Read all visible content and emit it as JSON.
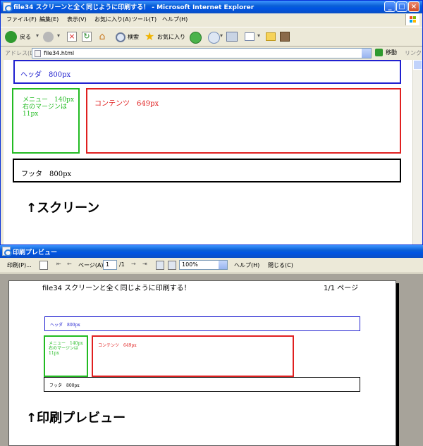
{
  "ie": {
    "title": "file34 スクリーンと全く同じように印刷する！ - Microsoft Internet Explorer",
    "menu": [
      "ファイル(F)",
      "編集(E)",
      "表示(V)",
      "お気に入り(A)",
      "ツール(T)",
      "ヘルプ(H)"
    ],
    "toolbar": {
      "back": "戻る",
      "search": "検索",
      "favorites": "お気に入り"
    },
    "address_label": "アドレス(D)",
    "address_value": "file34.html",
    "go_label": "移動",
    "links_label": "リンク"
  },
  "screen_page": {
    "header": "ヘッダ　800px",
    "menu_lines": [
      "メニュー　140px",
      "右のマージンは",
      "11px"
    ],
    "content": "コンテンツ　649px",
    "footer": "フッタ　800px"
  },
  "caption_screen": "↑スクリーン",
  "preview": {
    "title": "印刷プレビュー",
    "toolbar": {
      "print": "印刷(P)...",
      "page_label": "ページ(A)",
      "page_value": "1",
      "page_total": "/1",
      "zoom": "100%",
      "help": "ヘルプ(H)",
      "close": "閉じる(C)"
    },
    "paper_header_left": "file34 スクリーンと全く同じように印刷する！",
    "paper_header_right": "1/1 ページ",
    "page": {
      "header": "ヘッダ　800px",
      "menu_lines": [
        "メニュー　140px",
        "右のマージンは",
        "11px"
      ],
      "content": "コンテンツ　649px",
      "footer": "フッタ　800px"
    }
  },
  "caption_preview": "↑印刷プレビュー",
  "colors": {
    "header": "#2020d0",
    "menu": "#22bb22",
    "content": "#e02020",
    "footer": "#000000"
  }
}
